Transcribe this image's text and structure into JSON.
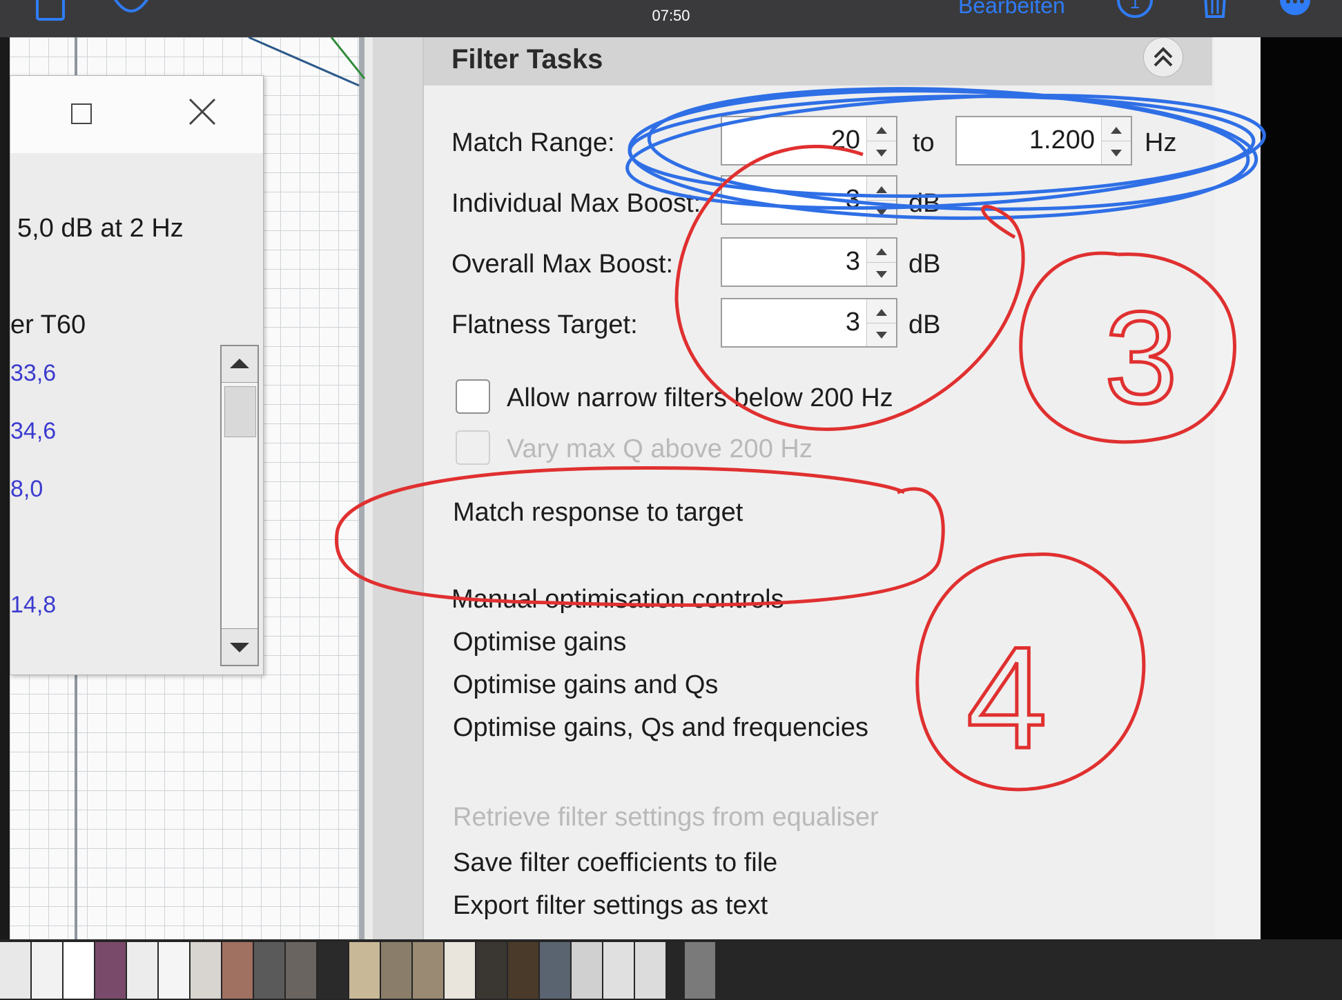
{
  "status_bar": {
    "time": "07:50"
  },
  "viewer_toolbar": {
    "edit_label": "Bearbeiten",
    "info_count": "1"
  },
  "dialog": {
    "line1": "5,0 dB at 2 Hz",
    "line2": "er T60",
    "values": [
      "33,6",
      "34,6",
      "8,0",
      "14,8"
    ]
  },
  "panel": {
    "title": "Filter Tasks",
    "match_range": {
      "label": "Match Range:",
      "from": "20",
      "to_label": "to",
      "to": "1.200",
      "unit": "Hz"
    },
    "individual_max_boost": {
      "label": "Individual Max Boost:",
      "value": "3",
      "unit": "dB"
    },
    "overall_max_boost": {
      "label": "Overall Max Boost:",
      "value": "3",
      "unit": "dB"
    },
    "flatness_target": {
      "label": "Flatness Target:",
      "value": "3",
      "unit": "dB"
    },
    "allow_narrow": {
      "label": "Allow narrow filters below 200 Hz",
      "checked": false
    },
    "vary_max_q": {
      "label": "Vary max Q above 200 Hz",
      "enabled": false
    },
    "match_response": "Match response to target",
    "manual_controls": "Manual optimisation controls",
    "optimise_gains": "Optimise gains",
    "optimise_gains_qs": "Optimise gains and Qs",
    "optimise_gains_qs_freq": "Optimise gains, Qs and frequencies",
    "retrieve": "Retrieve filter settings from equaliser",
    "save_coeffs": "Save filter coefficients to file",
    "export_text": "Export filter settings as text"
  },
  "annotations": {
    "step_3": "3",
    "step_4": "4"
  },
  "colors": {
    "annotation_blue": "#2f6fe6",
    "annotation_red": "#e03030",
    "link_blue": "#2f7cf6",
    "value_blue": "#3b3bcf"
  }
}
